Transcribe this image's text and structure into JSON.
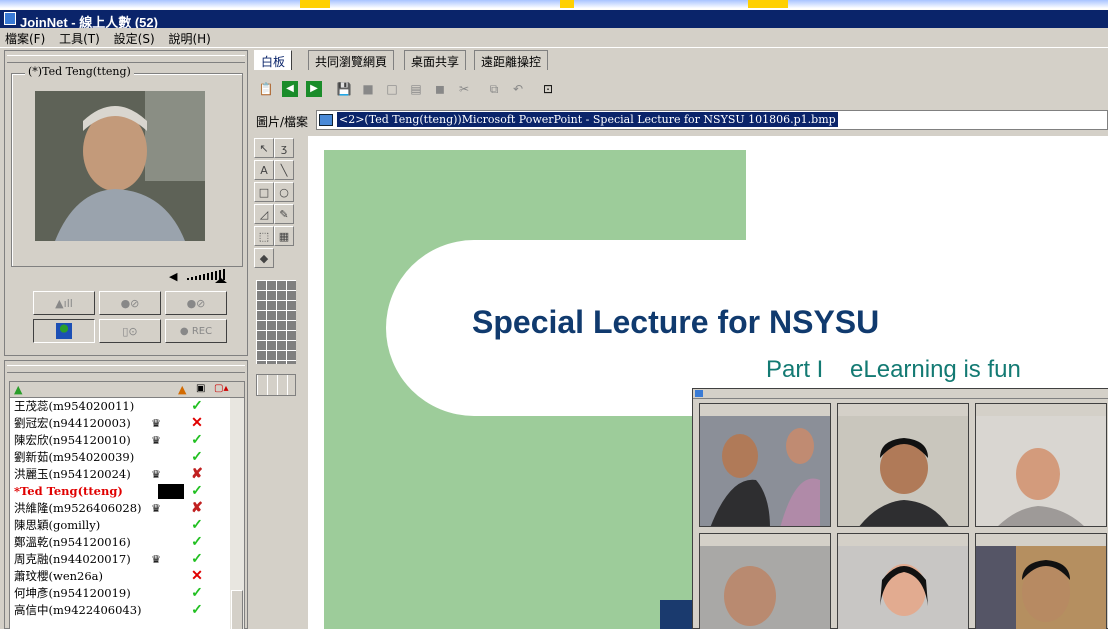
{
  "window": {
    "title": "JoinNet - 線上人數 (52)"
  },
  "menu": [
    "檔案(F)",
    "工具(T)",
    "設定(S)",
    "說明(H)"
  ],
  "video": {
    "caption": "(*)Ted Teng(tteng)",
    "rec_label": "● REC"
  },
  "tabs": [
    "白板",
    "共同瀏覽網頁",
    "桌面共享",
    "遠距離操控"
  ],
  "file_bar": {
    "label": "圖片/檔案",
    "value": "<2>(Ted Teng(tteng))Microsoft PowerPoint - Special Lecture for NSYSU 101806.p1.bmp"
  },
  "slide": {
    "title": "Special Lecture for NSYSU",
    "subtitle": "Part I    eLearning is fun"
  },
  "colors": {
    "title_bar": "#0a246a",
    "slide_green": "#9dcc9a",
    "slide_title": "#103a6e",
    "slide_subtitle": "#137a73",
    "ok": "#22c022",
    "no": "#e00000"
  },
  "participants": [
    {
      "name": "王茂蕊(m954020011)",
      "crown": false,
      "status": "ok"
    },
    {
      "name": "劉冠宏(n944120003)",
      "crown": true,
      "status": "no"
    },
    {
      "name": "陳宏欣(n954120010)",
      "crown": true,
      "status": "ok"
    },
    {
      "name": "劉新茹(m954020039)",
      "crown": false,
      "status": "ok"
    },
    {
      "name": "洪麗玉(n954120024)",
      "crown": true,
      "status": "warn"
    },
    {
      "name": "*Ted Teng(tteng)",
      "crown": false,
      "status": "ok",
      "host": true
    },
    {
      "name": "洪維隆(m9526406028)",
      "crown": true,
      "status": "warn"
    },
    {
      "name": "陳思穎(gomilly)",
      "crown": false,
      "status": "ok"
    },
    {
      "name": "鄭溫乾(n954120016)",
      "crown": false,
      "status": "ok"
    },
    {
      "name": "周克融(n944020017)",
      "crown": true,
      "status": "ok"
    },
    {
      "name": "蕭玟櫻(wen26a)",
      "crown": false,
      "status": "no"
    },
    {
      "name": "何坤彥(n954120019)",
      "crown": false,
      "status": "ok"
    },
    {
      "name": "高信中(m9422406043)",
      "crown": false,
      "status": "ok"
    }
  ],
  "icons": {
    "crown": "crown-icon",
    "ok": "checkmark-icon",
    "no": "cross-icon"
  }
}
